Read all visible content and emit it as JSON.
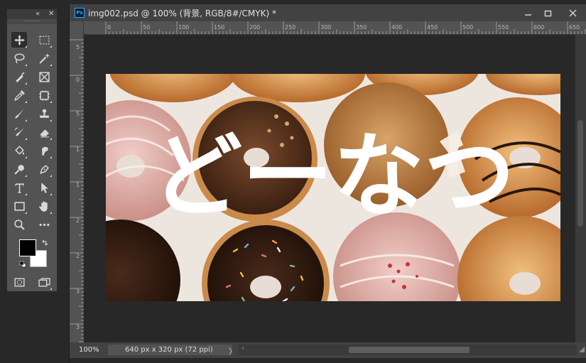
{
  "document": {
    "title": "img002.psd @ 100% (背景, RGB/8#/CMYK) *",
    "app_icon_label": "Ps",
    "zoom": "100%",
    "info": "640 px x 320 px (72 ppi)",
    "status_arrow": "〉",
    "hscroll_left": "‹"
  },
  "window_controls": [
    {
      "name": "minimize",
      "icon": "minimize-icon"
    },
    {
      "name": "restore",
      "icon": "restore-icon"
    },
    {
      "name": "close",
      "icon": "close-icon"
    }
  ],
  "toolbox": {
    "collapse_label": "«",
    "close_label": "✕",
    "tools": [
      [
        "move-tool",
        "marquee-tool"
      ],
      [
        "lasso-tool",
        "magic-wand-tool"
      ],
      [
        "pen-slice-tool",
        "frame-tool"
      ],
      [
        "eyedropper-tool",
        "patch-tool"
      ],
      [
        "brush-tool",
        "clone-stamp-tool"
      ],
      [
        "history-brush-tool",
        "eraser-tool"
      ],
      [
        "paint-bucket-tool",
        "smudge-tool"
      ],
      [
        "dodge-tool",
        "pen-tool"
      ],
      [
        "type-tool",
        "path-selection-tool"
      ],
      [
        "rectangle-tool",
        "hand-tool"
      ],
      [
        "zoom-tool",
        "more-tools"
      ]
    ],
    "foreground_color": "#000000",
    "background_color": "#ffffff"
  },
  "ruler": {
    "horizontal_labels": [
      "0",
      "50",
      "100",
      "150",
      "200",
      "250",
      "300",
      "350",
      "400",
      "450",
      "500",
      "550",
      "600",
      "650"
    ],
    "vertical_labels": [
      "5",
      "0",
      "5",
      "1",
      "1",
      "2",
      "2",
      "3",
      "3"
    ]
  },
  "image": {
    "overlay_text": "どーなつ",
    "alt": "photo of assorted glazed donuts with sprinkles"
  }
}
